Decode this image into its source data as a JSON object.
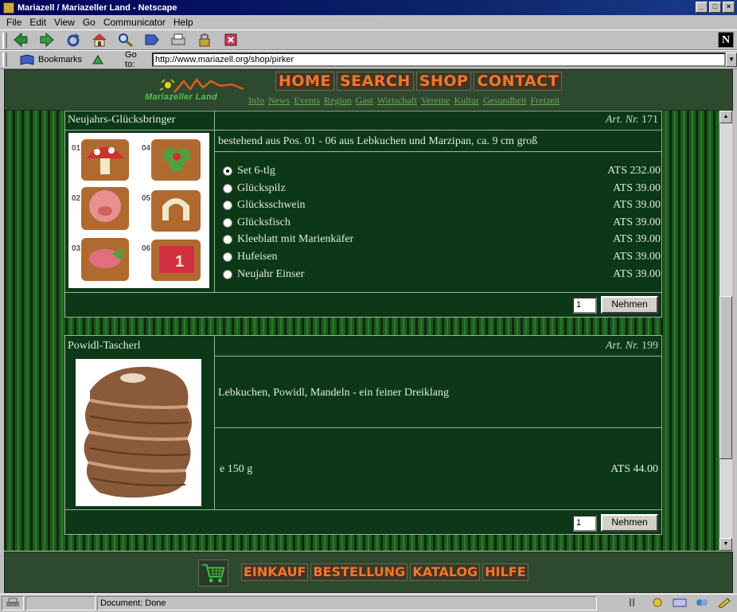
{
  "window": {
    "title": "Mariazell / Mariazeller Land - Netscape"
  },
  "menu": [
    "File",
    "Edit",
    "View",
    "Go",
    "Communicator",
    "Help"
  ],
  "toolbar": {
    "icons": [
      "back-icon",
      "forward-icon",
      "reload-icon",
      "home-icon",
      "search-icon",
      "netscape-guide-icon",
      "print-icon",
      "security-icon",
      "stop-icon"
    ]
  },
  "location": {
    "bookmarks_label": "Bookmarks",
    "goto_label": "Go to:",
    "url": "http://www.mariazell.org/shop/pirker"
  },
  "site": {
    "logo_text": "Mariazeller Land",
    "main_nav": [
      "HOME",
      "SEARCH",
      "SHOP",
      "CONTACT"
    ],
    "sub_nav": [
      "Info",
      "News",
      "Events",
      "Region",
      "Gast",
      "Wirtschaft",
      "Vereine",
      "Kultur",
      "Gesundheit",
      "Freizeit"
    ],
    "bottom_nav": [
      "EINKAUF",
      "BESTELLUNG",
      "KATALOG",
      "HILFE"
    ]
  },
  "products": [
    {
      "title": "Neujahrs-Glücksbringer",
      "art_label": "Art. Nr.",
      "art_no": "171",
      "description": "bestehend aus Pos. 01 - 06 aus Lebkuchen und Marzipan, ca. 9 cm groß",
      "image_labels": [
        "01",
        "04",
        "02",
        "05",
        "03",
        "06"
      ],
      "options": [
        {
          "label": "Set 6-tlg",
          "price": "ATS 232.00",
          "checked": true
        },
        {
          "label": "Glückspilz",
          "price": "ATS 39.00",
          "checked": false
        },
        {
          "label": "Glücksschwein",
          "price": "ATS 39.00",
          "checked": false
        },
        {
          "label": "Glücksfisch",
          "price": "ATS 39.00",
          "checked": false
        },
        {
          "label": "Kleeblatt mit Marienkäfer",
          "price": "ATS 39.00",
          "checked": false
        },
        {
          "label": "Hufeisen",
          "price": "ATS 39.00",
          "checked": false
        },
        {
          "label": "Neujahr Einser",
          "price": "ATS 39.00",
          "checked": false
        }
      ],
      "qty": "1",
      "button": "Nehmen"
    },
    {
      "title": "Powidl-Tascherl",
      "art_label": "Art. Nr.",
      "art_no": "199",
      "description": "Lebkuchen, Powidl, Mandeln - ein feiner Dreiklang",
      "weight": "e 150 g",
      "price": "ATS 44.00",
      "qty": "1",
      "button": "Nehmen"
    }
  ],
  "status": {
    "text": "Document: Done"
  }
}
